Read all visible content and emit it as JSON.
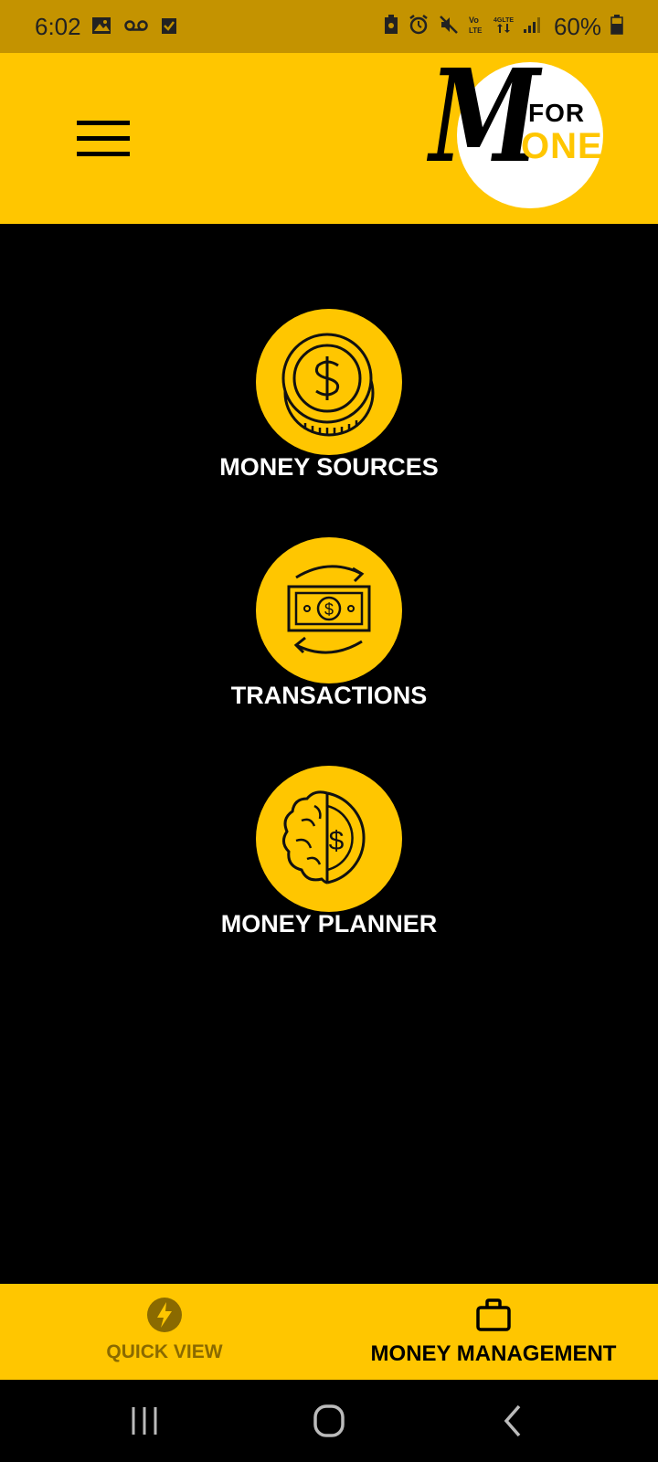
{
  "status_bar": {
    "time": "6:02",
    "battery": "60%",
    "color": "#C49300"
  },
  "header": {
    "menu_icon": "hamburger-icon",
    "logo": {
      "for_text": "FOR",
      "oney_text": "ONEY",
      "m_letter": "M"
    },
    "color": "#FFC600"
  },
  "menu": {
    "items": [
      {
        "label": "MONEY SOURCES",
        "icon": "coin-dollar-icon"
      },
      {
        "label": "TRANSACTIONS",
        "icon": "money-exchange-icon"
      },
      {
        "label": "MONEY PLANNER",
        "icon": "brain-coin-icon"
      }
    ]
  },
  "bottom_nav": {
    "tabs": [
      {
        "label": "QUICK VIEW",
        "icon": "lightning-icon",
        "active": false
      },
      {
        "label": "MONEY MANAGEMENT",
        "icon": "briefcase-icon",
        "active": true
      }
    ]
  },
  "colors": {
    "accent": "#FFC600",
    "background": "#000000",
    "inactive_tab": "#8A6A00",
    "label": "#FFFFFF"
  }
}
